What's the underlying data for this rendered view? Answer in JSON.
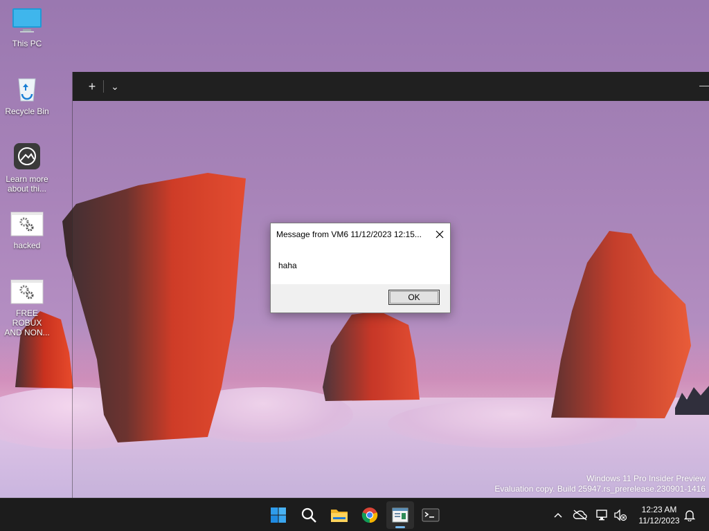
{
  "desktop": {
    "icons": [
      {
        "label": "This PC",
        "icon": "monitor-icon"
      },
      {
        "label": "Recycle Bin",
        "icon": "recycle-bin-icon"
      },
      {
        "label": "Learn more about thi...",
        "icon": "learn-more-icon"
      },
      {
        "label": "hacked",
        "icon": "settings-gear-icon"
      },
      {
        "label": "FREE ROBUX AND NON...",
        "icon": "settings-gear-icon"
      }
    ]
  },
  "terminal": {
    "new_tab_label": "+",
    "dropdown_label": "⌄",
    "minimize_label": "—"
  },
  "dialog": {
    "title": "Message from VM6 11/12/2023 12:15...",
    "message": "haha",
    "ok_label": "OK"
  },
  "watermark": {
    "line1": "Windows 11 Pro Insider Preview",
    "line2": "Evaluation copy. Build 25947.rs_prerelease.230901-1416"
  },
  "taskbar": {
    "apps": [
      "start-icon",
      "search-icon",
      "file-explorer-icon",
      "chrome-icon",
      "message-app-icon",
      "terminal-icon"
    ],
    "tray": [
      "chevron-up-icon",
      "cloud-off-icon",
      "network-icon",
      "volume-muted-icon"
    ],
    "time": "12:23 AM",
    "date": "11/12/2023"
  },
  "colors": {
    "accent": "#76b9ed",
    "taskbar": "#1c1c1c",
    "titlebar": "#202020",
    "rock_red": "#c8301c"
  }
}
